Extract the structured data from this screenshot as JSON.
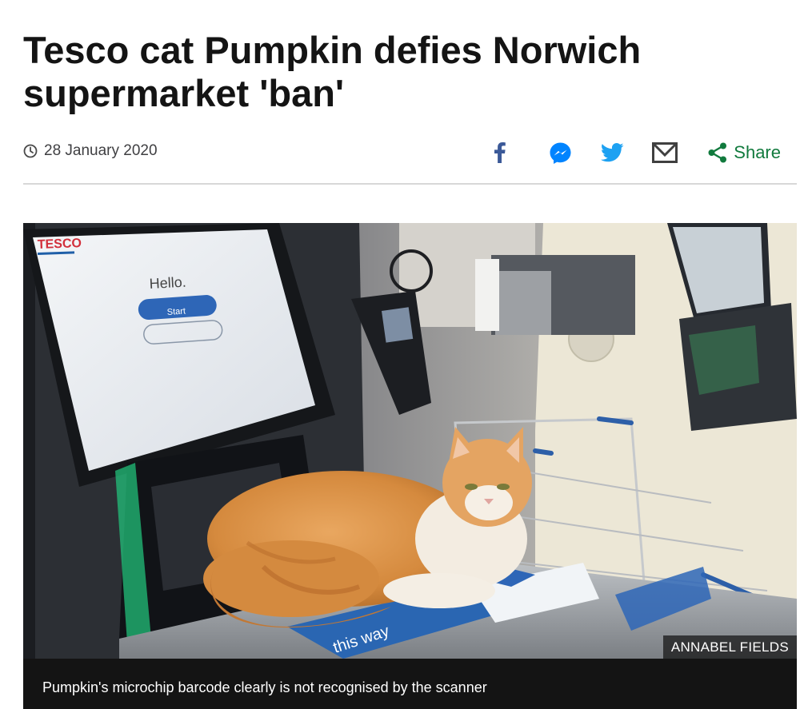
{
  "article": {
    "headline": "Tesco cat Pumpkin defies Norwich supermarket 'ban'",
    "date": "28 January 2020"
  },
  "share_tools": {
    "items": [
      {
        "icon": "facebook-icon",
        "color": "#3b5998"
      },
      {
        "icon": "messenger-icon",
        "color": "#0084ff"
      },
      {
        "icon": "twitter-icon",
        "color": "#1da1f2"
      },
      {
        "icon": "email-icon",
        "color": "#404040"
      }
    ],
    "share_label": "Share",
    "share_color": "#117a3d"
  },
  "figure": {
    "credit": "ANNABEL FIELDS",
    "caption": "Pumpkin's microchip barcode clearly is not recognised by the scanner",
    "screen": {
      "brand": "TESCO",
      "greeting": "Hello.",
      "button": "Start",
      "pad_label": "this way"
    }
  },
  "colors": {
    "headline": "#141414",
    "caption_bg": "#141414",
    "divider": "#d8d8d8"
  }
}
